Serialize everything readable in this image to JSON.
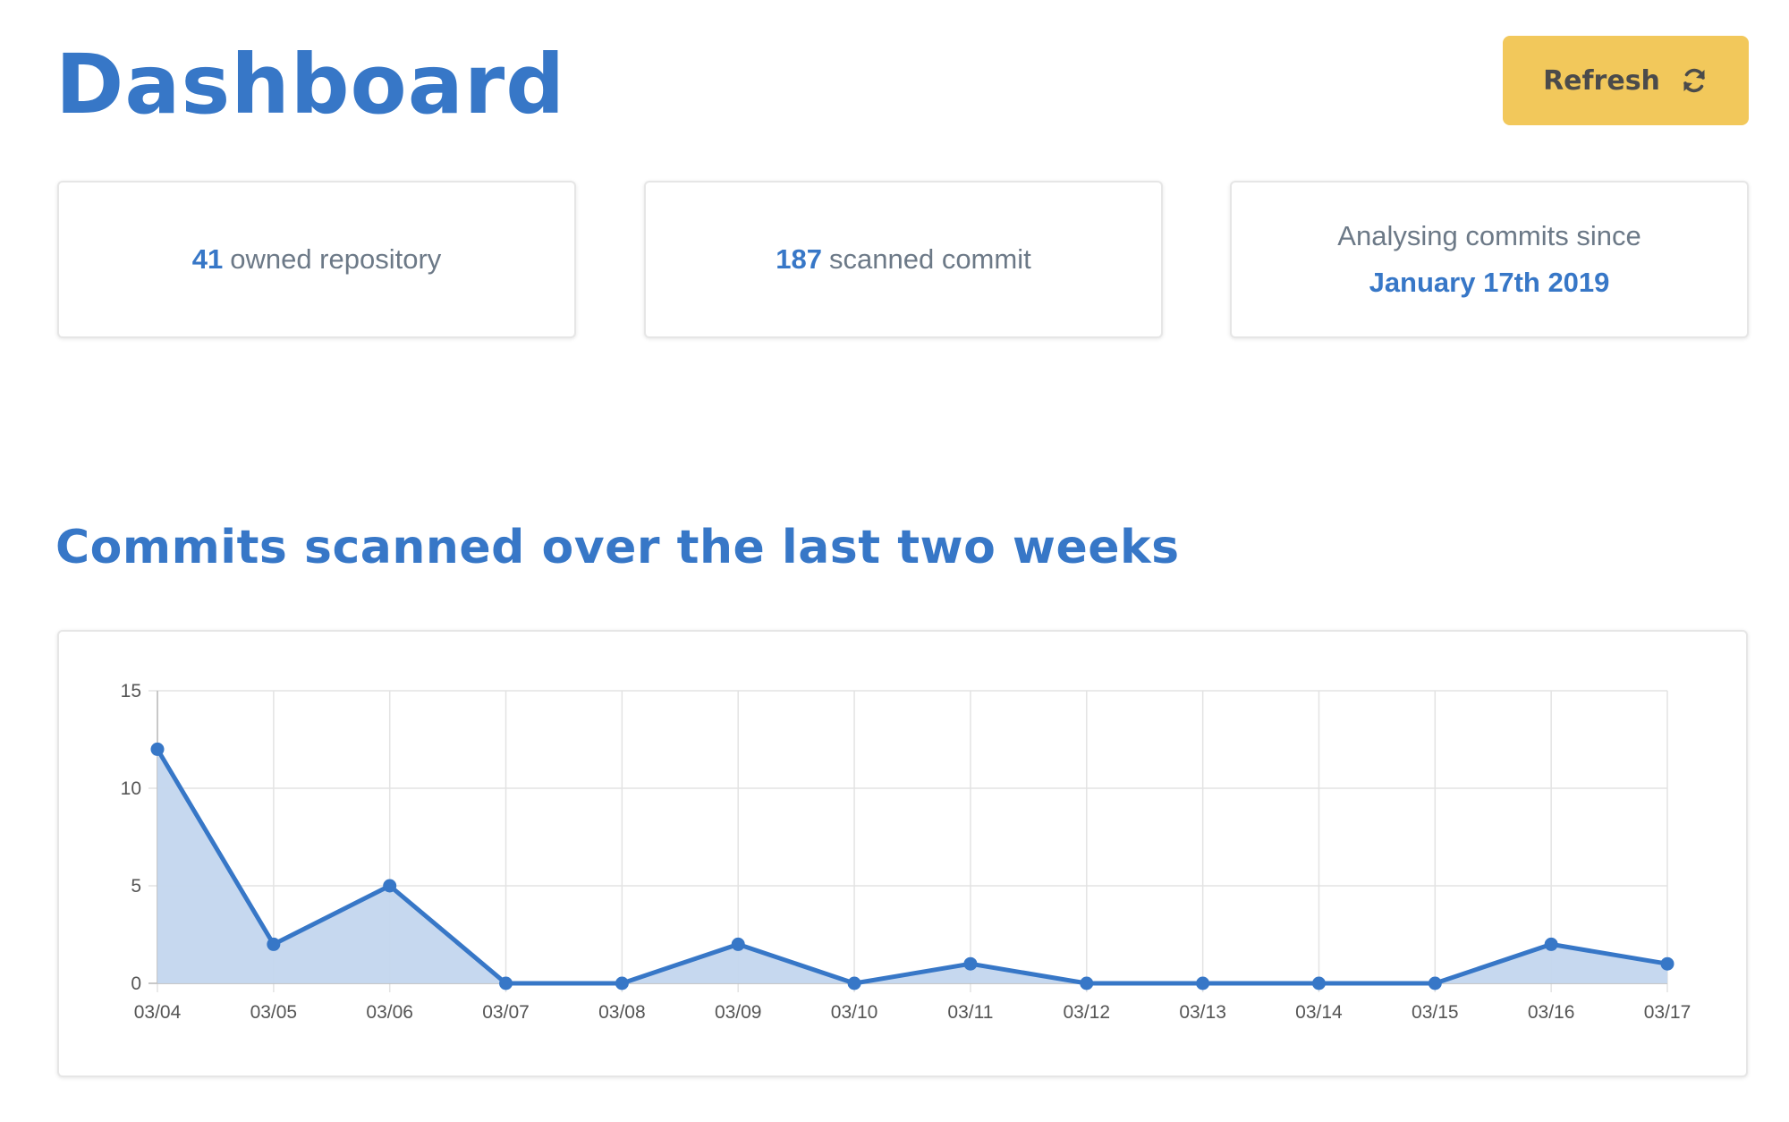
{
  "header": {
    "title": "Dashboard",
    "refresh_label": "Refresh",
    "refresh_icon": "refresh-icon",
    "refresh_color": "#f2c85b"
  },
  "stats": {
    "repos": {
      "number": "41",
      "label": "owned repository"
    },
    "commits": {
      "number": "187",
      "label": "scanned commit"
    },
    "since": {
      "caption": "Analysing commits since",
      "date": "January 17th 2019"
    }
  },
  "section": {
    "title": "Commits scanned over the last two weeks"
  },
  "colors": {
    "accent": "#3777c7",
    "fill": "#c3d6ee",
    "muted": "#6c7987"
  },
  "chart_data": {
    "type": "area",
    "categories": [
      "03/04",
      "03/05",
      "03/06",
      "03/07",
      "03/08",
      "03/09",
      "03/10",
      "03/11",
      "03/12",
      "03/13",
      "03/14",
      "03/15",
      "03/16",
      "03/17"
    ],
    "series": [
      {
        "values": [
          12,
          2,
          5,
          0,
          0,
          2,
          0,
          1,
          0,
          0,
          0,
          0,
          2,
          1
        ]
      }
    ],
    "ylim": [
      0,
      15
    ],
    "yticks": [
      0,
      5,
      10,
      15
    ],
    "grid": true,
    "legend": "none"
  }
}
